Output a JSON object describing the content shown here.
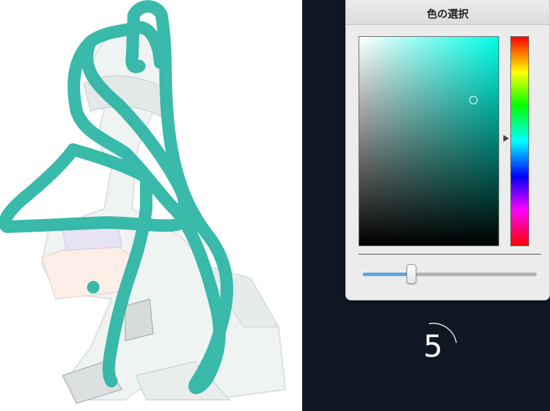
{
  "picker": {
    "title": "色の選択",
    "hue_value": 0.48,
    "saturation_value": 0.8,
    "brightness_value": 0.7,
    "opacity_fraction": 0.28
  },
  "brush_color": "#2bb5a4",
  "countdown": {
    "value": "5"
  }
}
